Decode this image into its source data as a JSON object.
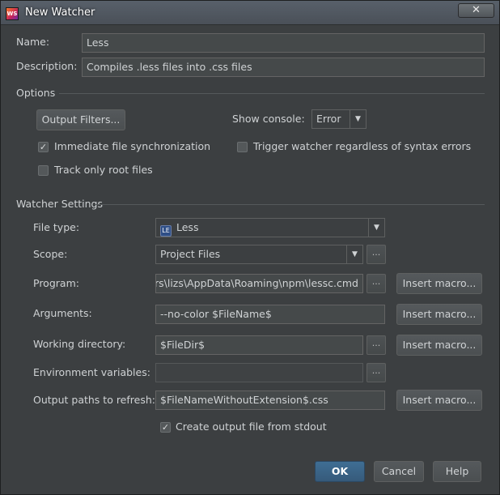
{
  "window": {
    "title": "New Watcher",
    "icon_name": "webstorm-app-icon",
    "close_label": "✕"
  },
  "name": {
    "label": "Name:",
    "value": "Less"
  },
  "description": {
    "label": "Description:",
    "value": "Compiles .less files into .css files"
  },
  "options": {
    "section_title": "Options",
    "output_filters_label": "Output Filters...",
    "show_console_label": "Show console:",
    "show_console_value": "Error",
    "immediate_sync": {
      "label": "Immediate file synchronization",
      "checked": true
    },
    "trigger_regardless": {
      "label": "Trigger watcher regardless of syntax errors",
      "checked": false
    },
    "track_root_only": {
      "label": "Track only root files",
      "checked": false
    }
  },
  "watcher_settings": {
    "section_title": "Watcher Settings",
    "file_type": {
      "label": "File type:",
      "value": "Less",
      "icon_name": "less-file-icon"
    },
    "scope": {
      "label": "Scope:",
      "value": "Project Files"
    },
    "program": {
      "label": "Program:",
      "value": "ers\\lizs\\AppData\\Roaming\\npm\\lessc.cmd"
    },
    "arguments": {
      "label": "Arguments:",
      "value": "--no-color $FileName$"
    },
    "working_directory": {
      "label": "Working directory:",
      "value": "$FileDir$"
    },
    "environment_variables": {
      "label": "Environment variables:",
      "value": ""
    },
    "output_paths": {
      "label": "Output paths to refresh:",
      "value": "$FileNameWithoutExtension$.css"
    },
    "create_output_from_stdout": {
      "label": "Create output file from stdout",
      "checked": true
    },
    "insert_macro_label": "Insert macro...",
    "browse_label": "..."
  },
  "footer": {
    "ok_label": "OK",
    "cancel_label": "Cancel",
    "help_label": "Help"
  }
}
